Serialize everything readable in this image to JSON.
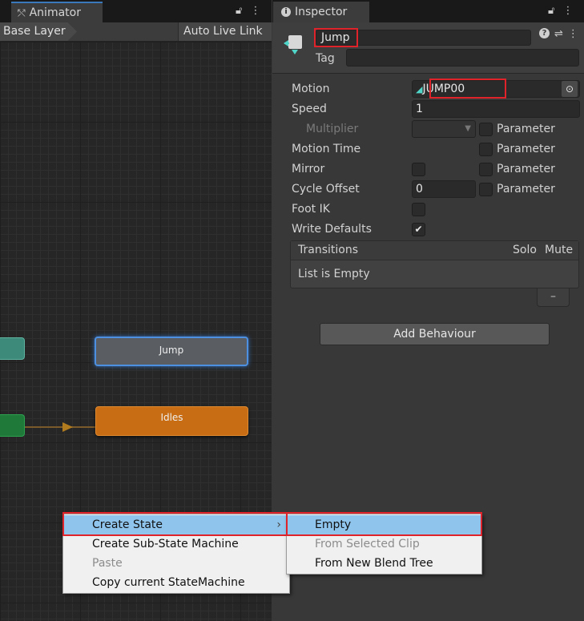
{
  "animator": {
    "tab_label": "Animator",
    "breadcrumb": "Base Layer",
    "auto_live_link": "Auto Live Link",
    "states": {
      "jump": "Jump",
      "idles": "Idles"
    }
  },
  "inspector": {
    "tab_label": "Inspector",
    "state_name": "Jump",
    "tag_label": "Tag",
    "tag_value": "",
    "fields": {
      "motion_label": "Motion",
      "motion_value": "JUMP00",
      "speed_label": "Speed",
      "speed_value": "1",
      "multiplier_label": "Multiplier",
      "motion_time_label": "Motion Time",
      "mirror_label": "Mirror",
      "cycle_offset_label": "Cycle Offset",
      "cycle_offset_value": "0",
      "foot_ik_label": "Foot IK",
      "write_defaults_label": "Write Defaults",
      "parameter_label": "Parameter"
    },
    "transitions": {
      "title": "Transitions",
      "solo": "Solo",
      "mute": "Mute",
      "empty_text": "List is Empty",
      "remove_label": "–"
    },
    "add_behaviour": "Add Behaviour"
  },
  "context_menu": {
    "items": [
      "Create State",
      "Create Sub-State Machine",
      "Paste",
      "Copy current StateMachine"
    ],
    "submenu_items": [
      "Empty",
      "From Selected Clip",
      "From New Blend Tree"
    ]
  },
  "colors": {
    "highlight_red": "#e0222a",
    "menu_selection": "#8fc4ec",
    "jump_state": "#5a5e63",
    "idles_state": "#c86d14",
    "selection_blue": "#4d8fe0"
  }
}
